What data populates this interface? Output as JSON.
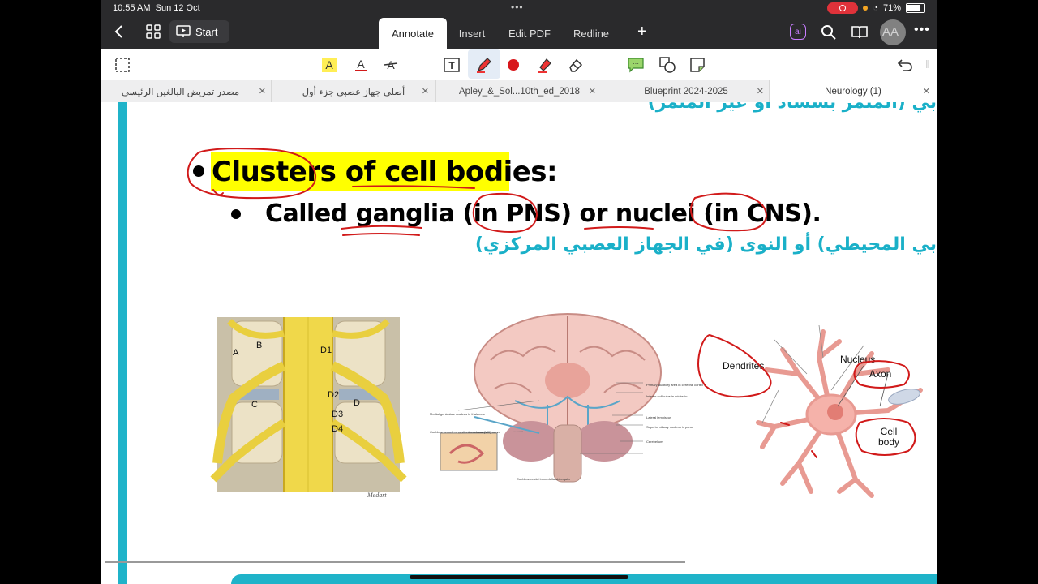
{
  "status": {
    "time": "10:55 AM",
    "date": "Sun 12 Oct",
    "battery": "71%"
  },
  "topbar": {
    "start_label": "Start",
    "tabs": [
      {
        "label": "Annotate",
        "active": true
      },
      {
        "label": "Insert",
        "active": false
      },
      {
        "label": "Edit PDF",
        "active": false
      },
      {
        "label": "Redline",
        "active": false
      }
    ],
    "ai_label": "ai",
    "text_size_label": "AA"
  },
  "doc_tabs": [
    {
      "label": "مصدر تمريض البالغين الرئيسي",
      "active": false
    },
    {
      "label": "أصلي جهاز عصبي جزء أول",
      "active": false
    },
    {
      "label": "Apley_&_Sol...10th_ed_2018",
      "active": false
    },
    {
      "label": "Blueprint 2024-2025",
      "active": false
    },
    {
      "label": "Neurology (1)",
      "active": true
    }
  ],
  "colors": {
    "accent": "#1fb3c9",
    "highlight": "#ffff00",
    "ink": "#d11a1a",
    "topbar": "#2a2a2c"
  },
  "slide": {
    "arabic_top": "بي (المتمر بسساد أو غير المتمر)",
    "heading": "Clusters of cell bodies:",
    "subline": "Called ganglia (in PNS) or nuclei (in CNS).",
    "arabic_line": "بي المحيطي) أو النوى (في الجهاز العصبي المركزي)"
  },
  "figures": {
    "spine_labels": [
      "A",
      "B",
      "C",
      "D1",
      "D2",
      "D",
      "D3",
      "D4"
    ],
    "spine_signature": "Medart",
    "brain_labels": [
      "Primary auditory area in cerebral cortex",
      "Medial geniculate nucleus in thalamus",
      "Inferior colliculus in midbrain",
      "Lateral lemniscus",
      "Cochlear branch of vestibulocochlear (VIII) nerve",
      "Superior olivary nucleus in pons",
      "Cerebellum",
      "Cochlear nuclei in medulla oblongata"
    ],
    "neuron_labels": {
      "dendrites": "Dendrites",
      "nucleus": "Nucleus",
      "axon": "Axon",
      "cell_body": "Cell body"
    }
  }
}
